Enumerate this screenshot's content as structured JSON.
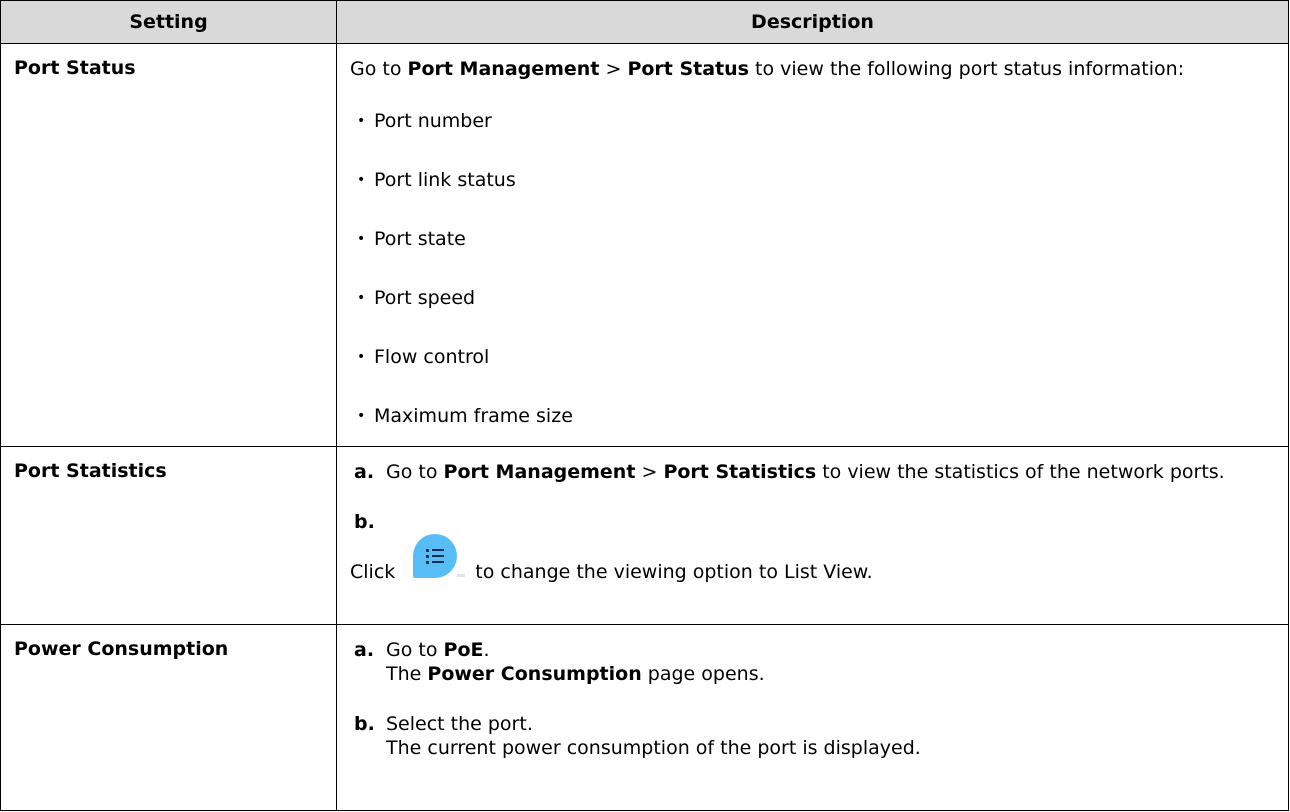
{
  "table": {
    "headers": [
      "Setting",
      "Description"
    ],
    "port_status": {
      "setting": "Port Status",
      "intro": {
        "goto": "Go to",
        "menu": "Port Management",
        "sep": ">",
        "page": "Port Status",
        "rest": "to view the following port status information:"
      },
      "bullets": [
        "Port number",
        "Port link status",
        "Port state",
        "Port speed",
        "Flow control",
        "Maximum frame size"
      ]
    },
    "port_statistics": {
      "setting": "Port Statistics",
      "step_a": {
        "label": "a.",
        "goto": "Go to",
        "menu": "Port Management",
        "sep": ">",
        "page": "Port Statistics",
        "rest": "to view the statistics of the network ports."
      },
      "step_b": {
        "label": "b.",
        "click": "Click",
        "rest": "to change the viewing option to List View.",
        "icon": "list-view-icon"
      }
    },
    "power_consumption": {
      "setting": "Power Consumption",
      "step_a": {
        "label": "a.",
        "goto": "Go to",
        "menu": "PoE",
        "period": ".",
        "result_prefix": "The",
        "result_bold": "Power Consumption",
        "result_suffix": "page opens."
      },
      "step_b": {
        "label": "b.",
        "text": "Select the port.",
        "result": "The current power consumption of the port is displayed."
      }
    }
  },
  "colors": {
    "header_bg": "#d9d9d9",
    "border": "#000000",
    "icon_bg": "#59bdf5",
    "icon_fg": "#0b2d52"
  }
}
